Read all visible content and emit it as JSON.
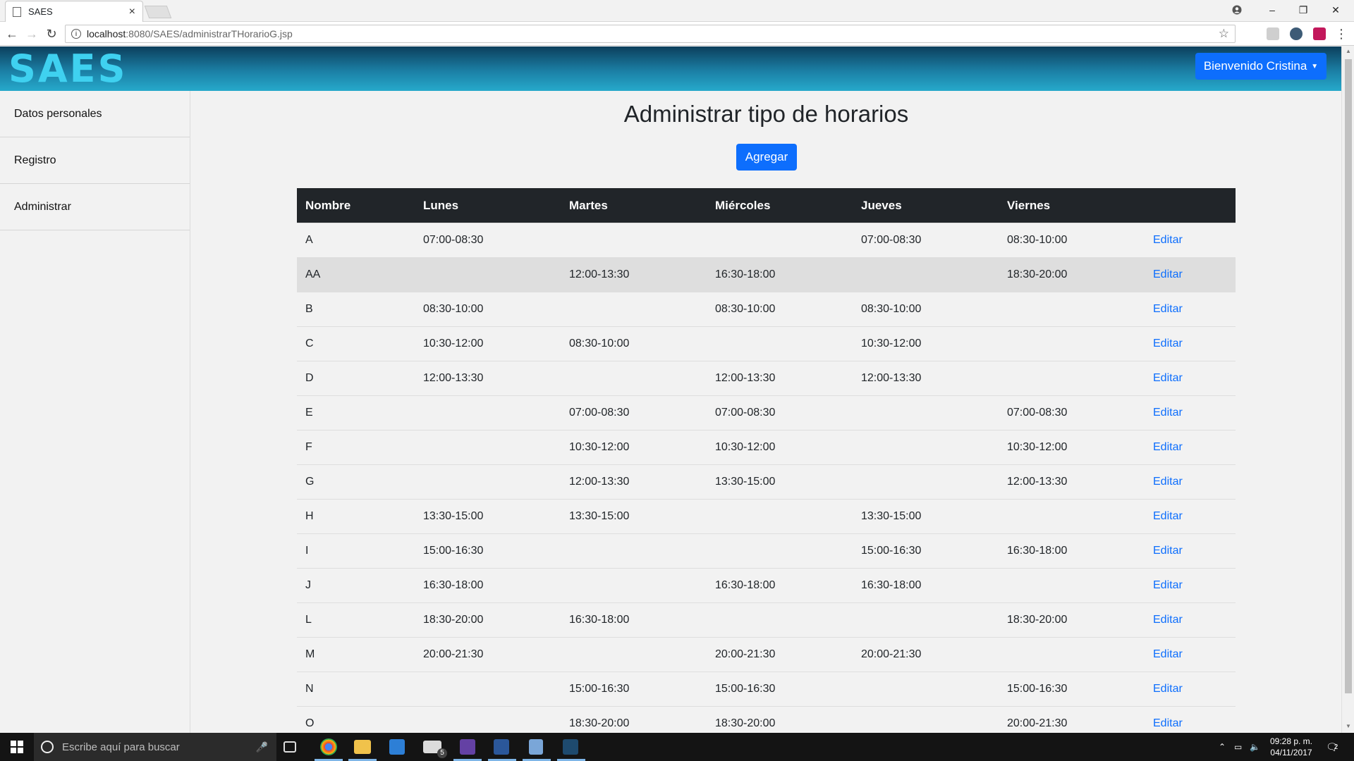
{
  "browser": {
    "tab_title": "SAES",
    "tab_close": "×",
    "url_host": "localhost",
    "url_path": ":8080/SAES/administrarTHorarioG.jsp",
    "window_controls": [
      "–",
      "❐",
      "✕"
    ],
    "nav_icons": [
      "back-icon",
      "forward-icon",
      "reload-icon"
    ]
  },
  "header": {
    "logo": "SAES",
    "user_button": "Bienvenido Cristina",
    "colors": {
      "header_start": "#0c3f5c",
      "header_end": "#26a9cb",
      "logo": "#3fd1f0",
      "button": "#0d6efd"
    }
  },
  "sidebar": {
    "items": [
      {
        "label": "Datos personales"
      },
      {
        "label": "Registro"
      },
      {
        "label": "Administrar"
      }
    ]
  },
  "main": {
    "title": "Administrar tipo de horarios",
    "add_button": "Agregar",
    "table": {
      "headers": [
        "Nombre",
        "Lunes",
        "Martes",
        "Miércoles",
        "Jueves",
        "Viernes",
        ""
      ],
      "rows": [
        [
          "A",
          "07:00-08:30",
          "",
          "",
          "07:00-08:30",
          "08:30-10:00",
          "Editar"
        ],
        [
          "AA",
          "",
          "12:00-13:30",
          "16:30-18:00",
          "",
          "18:30-20:00",
          "Editar"
        ],
        [
          "B",
          "08:30-10:00",
          "",
          "08:30-10:00",
          "08:30-10:00",
          "",
          "Editar"
        ],
        [
          "C",
          "10:30-12:00",
          "08:30-10:00",
          "",
          "10:30-12:00",
          "",
          "Editar"
        ],
        [
          "D",
          "12:00-13:30",
          "",
          "12:00-13:30",
          "12:00-13:30",
          "",
          "Editar"
        ],
        [
          "E",
          "",
          "07:00-08:30",
          "07:00-08:30",
          "",
          "07:00-08:30",
          "Editar"
        ],
        [
          "F",
          "",
          "10:30-12:00",
          "10:30-12:00",
          "",
          "10:30-12:00",
          "Editar"
        ],
        [
          "G",
          "",
          "12:00-13:30",
          "13:30-15:00",
          "",
          "12:00-13:30",
          "Editar"
        ],
        [
          "H",
          "13:30-15:00",
          "13:30-15:00",
          "",
          "13:30-15:00",
          "",
          "Editar"
        ],
        [
          "I",
          "15:00-16:30",
          "",
          "",
          "15:00-16:30",
          "16:30-18:00",
          "Editar"
        ],
        [
          "J",
          "16:30-18:00",
          "",
          "16:30-18:00",
          "16:30-18:00",
          "",
          "Editar"
        ],
        [
          "L",
          "18:30-20:00",
          "16:30-18:00",
          "",
          "",
          "18:30-20:00",
          "Editar"
        ],
        [
          "M",
          "20:00-21:30",
          "",
          "20:00-21:30",
          "20:00-21:30",
          "",
          "Editar"
        ],
        [
          "N",
          "",
          "15:00-16:30",
          "15:00-16:30",
          "",
          "15:00-16:30",
          "Editar"
        ],
        [
          "O",
          "",
          "18:30-20:00",
          "18:30-20:00",
          "",
          "20:00-21:30",
          "Editar"
        ]
      ]
    }
  },
  "taskbar": {
    "search_placeholder": "Escribe aquí para buscar",
    "time": "09:28 p. m.",
    "date": "04/11/2017",
    "mail_badge": "5",
    "notification_count": "2"
  }
}
